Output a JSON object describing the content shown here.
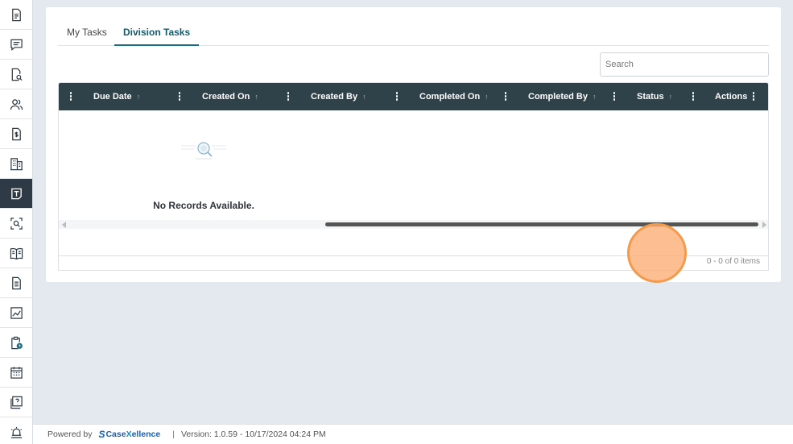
{
  "sidebar": {
    "items": [
      {
        "icon": "document-icon",
        "active": false
      },
      {
        "icon": "comment-icon",
        "active": false
      },
      {
        "icon": "document-search-icon",
        "active": false
      },
      {
        "icon": "users-icon",
        "active": false
      },
      {
        "icon": "invoice-icon",
        "active": false
      },
      {
        "icon": "building-icon",
        "active": false
      },
      {
        "icon": "task-icon",
        "active": true
      },
      {
        "icon": "scan-search-icon",
        "active": false
      },
      {
        "icon": "book-icon",
        "active": false
      },
      {
        "icon": "report-icon",
        "active": false
      },
      {
        "icon": "chart-icon",
        "active": false
      },
      {
        "icon": "clipboard-clock-icon",
        "active": false
      },
      {
        "icon": "calendar-icon",
        "active": false
      },
      {
        "icon": "help-icon",
        "active": false
      },
      {
        "icon": "alarm-icon",
        "active": false
      }
    ]
  },
  "tabs": [
    {
      "label": "My Tasks",
      "active": false
    },
    {
      "label": "Division Tasks",
      "active": true
    }
  ],
  "search": {
    "placeholder": "Search",
    "value": ""
  },
  "grid": {
    "columns": [
      {
        "label": "Due Date",
        "sort": "↑"
      },
      {
        "label": "Created On",
        "sort": "↑"
      },
      {
        "label": "Created By",
        "sort": "↑"
      },
      {
        "label": "Completed On",
        "sort": "↑"
      },
      {
        "label": "Completed By",
        "sort": "↑"
      },
      {
        "label": "Status",
        "sort": "↑"
      },
      {
        "label": "Actions",
        "sort": ""
      }
    ],
    "empty_message": "No Records Available.",
    "pager_info": "0 - 0 of 0 items"
  },
  "footer": {
    "powered_by": "Powered by",
    "brand_prefix": "Case",
    "brand_x": "X",
    "brand_suffix": "ellence",
    "separator": "|",
    "version": "Version: 1.0.59 - 10/17/2024 04:24 PM"
  },
  "colors": {
    "header_bg": "#2f4149",
    "active_tab": "#1c6f84",
    "sidebar_active": "#2e3a46",
    "brand": "#1a5fb4"
  }
}
